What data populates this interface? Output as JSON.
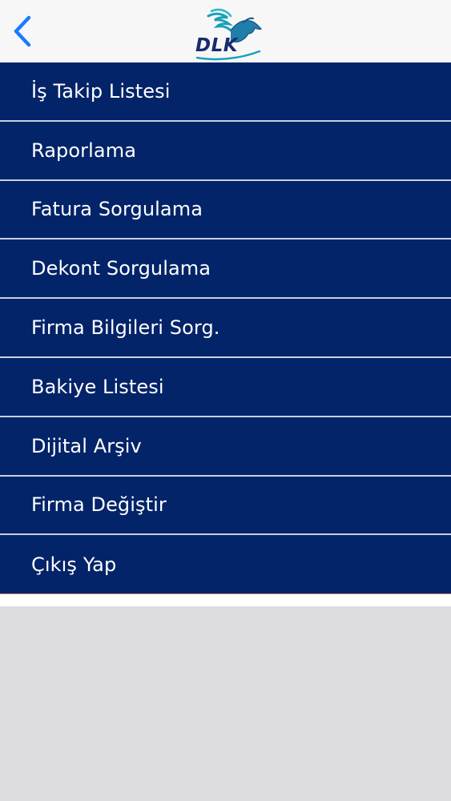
{
  "header": {
    "logo_text": "DLK",
    "back_icon": "chevron-left-icon",
    "accent_color": "#1a7bff"
  },
  "menu": {
    "background_color": "#032469",
    "items": [
      {
        "label": "İş Takip Listesi"
      },
      {
        "label": "Raporlama"
      },
      {
        "label": "Fatura Sorgulama"
      },
      {
        "label": "Dekont Sorgulama"
      },
      {
        "label": "Firma Bilgileri Sorg."
      },
      {
        "label": "Bakiye Listesi"
      },
      {
        "label": "Dijital Arşiv"
      },
      {
        "label": "Firma Değiştir"
      },
      {
        "label": "Çıkış Yap"
      }
    ]
  }
}
